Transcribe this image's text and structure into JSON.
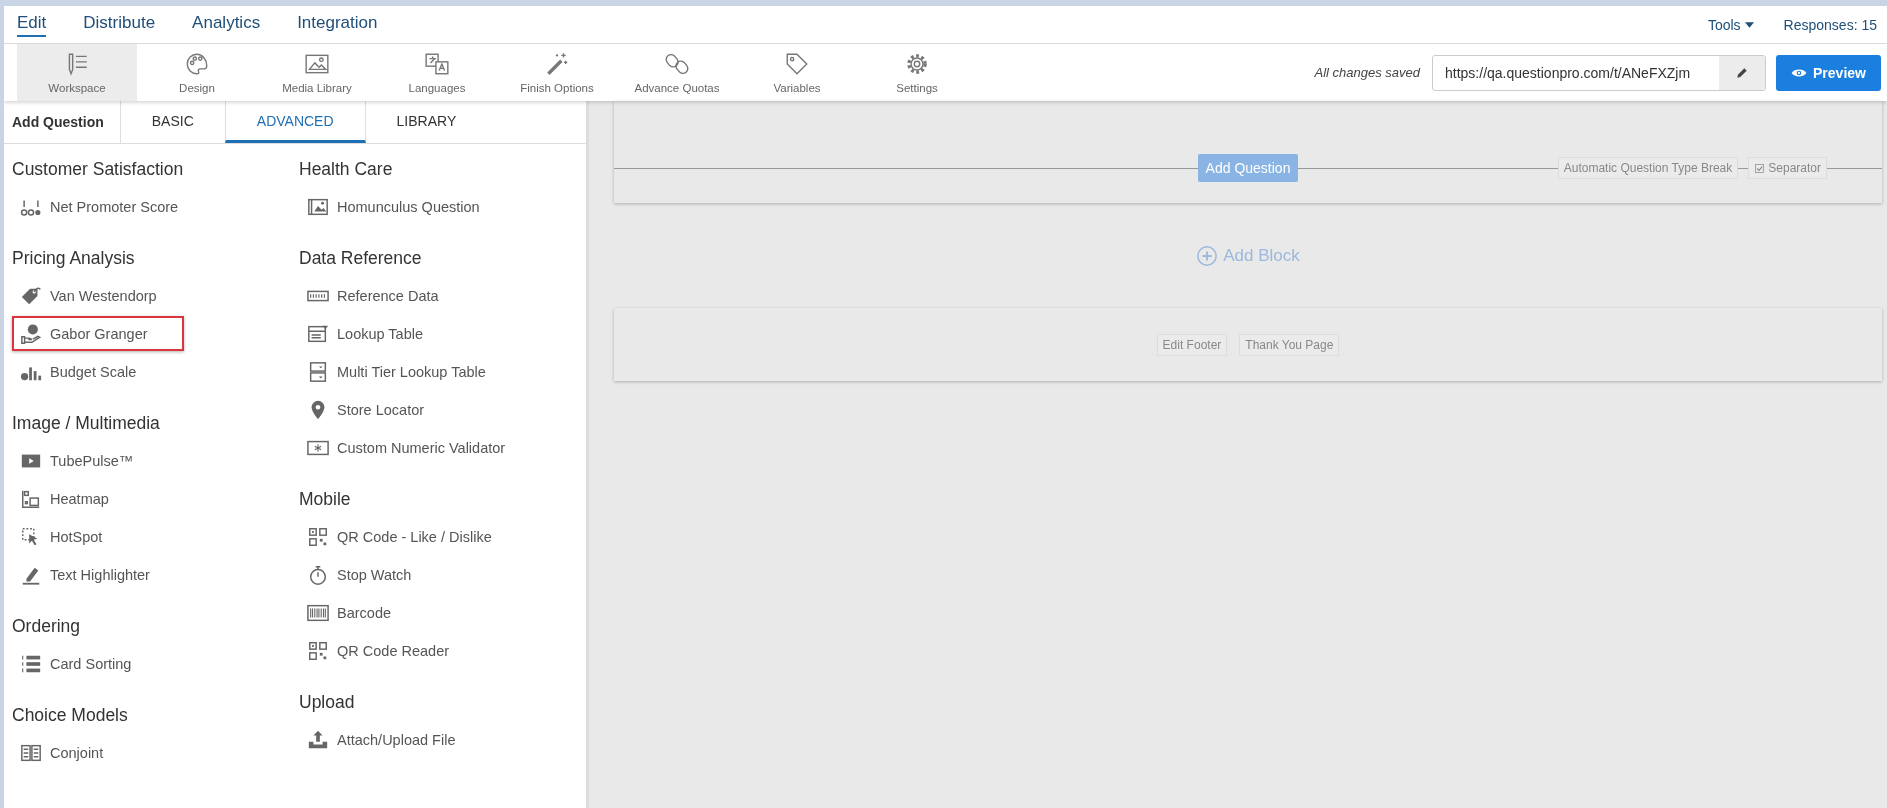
{
  "top_nav": {
    "tabs": [
      {
        "label": "Edit",
        "selected": true
      },
      {
        "label": "Distribute",
        "selected": false
      },
      {
        "label": "Analytics",
        "selected": false
      },
      {
        "label": "Integration",
        "selected": false
      }
    ],
    "tools": "Tools",
    "responses": "Responses: 15"
  },
  "toolbar": {
    "items": [
      {
        "label": "Workspace",
        "selected": true
      },
      {
        "label": "Design",
        "selected": false
      },
      {
        "label": "Media Library",
        "selected": false
      },
      {
        "label": "Languages",
        "selected": false
      },
      {
        "label": "Finish Options",
        "selected": false
      },
      {
        "label": "Advance Quotas",
        "selected": false
      },
      {
        "label": "Variables",
        "selected": false
      },
      {
        "label": "Settings",
        "selected": false
      }
    ],
    "save_status": "All changes saved",
    "url": "https://qa.questionpro.com/t/ANeFXZjm",
    "preview": "Preview"
  },
  "panel": {
    "title": "Add Question",
    "tabs": [
      {
        "label": "BASIC",
        "selected": false
      },
      {
        "label": "ADVANCED",
        "selected": true
      },
      {
        "label": "LIBRARY",
        "selected": false
      }
    ],
    "columns": [
      {
        "sections": [
          {
            "title": "Customer Satisfaction",
            "items": [
              {
                "label": "Net Promoter Score",
                "selected": false
              }
            ]
          },
          {
            "title": "Pricing Analysis",
            "items": [
              {
                "label": "Van Westendorp",
                "selected": false
              },
              {
                "label": "Gabor Granger",
                "selected": true
              },
              {
                "label": "Budget Scale",
                "selected": false
              }
            ]
          },
          {
            "title": "Image / Multimedia",
            "items": [
              {
                "label": "TubePulse™",
                "selected": false
              },
              {
                "label": "Heatmap",
                "selected": false
              },
              {
                "label": "HotSpot",
                "selected": false
              },
              {
                "label": "Text Highlighter",
                "selected": false
              }
            ]
          },
          {
            "title": "Ordering",
            "items": [
              {
                "label": "Card Sorting",
                "selected": false
              }
            ]
          },
          {
            "title": "Choice Models",
            "items": [
              {
                "label": "Conjoint",
                "selected": false
              }
            ]
          }
        ]
      },
      {
        "sections": [
          {
            "title": "Health Care",
            "items": [
              {
                "label": "Homunculus Question",
                "selected": false
              }
            ]
          },
          {
            "title": "Data Reference",
            "items": [
              {
                "label": "Reference Data",
                "selected": false
              },
              {
                "label": "Lookup Table",
                "selected": false
              },
              {
                "label": "Multi Tier Lookup Table",
                "selected": false
              },
              {
                "label": "Store Locator",
                "selected": false
              },
              {
                "label": "Custom Numeric Validator",
                "selected": false
              }
            ]
          },
          {
            "title": "Mobile",
            "items": [
              {
                "label": "QR Code - Like / Dislike",
                "selected": false
              },
              {
                "label": "Stop Watch",
                "selected": false
              },
              {
                "label": "Barcode",
                "selected": false
              },
              {
                "label": "QR Code Reader",
                "selected": false
              }
            ]
          },
          {
            "title": "Upload",
            "items": [
              {
                "label": "Attach/Upload File",
                "selected": false
              }
            ]
          }
        ]
      }
    ]
  },
  "canvas": {
    "add_question": "Add Question",
    "break_label": "Automatic Question Type Break",
    "separator": "Separator",
    "add_block": "Add Block",
    "footer_buttons": [
      "Edit Footer",
      "Thank You Page"
    ]
  }
}
